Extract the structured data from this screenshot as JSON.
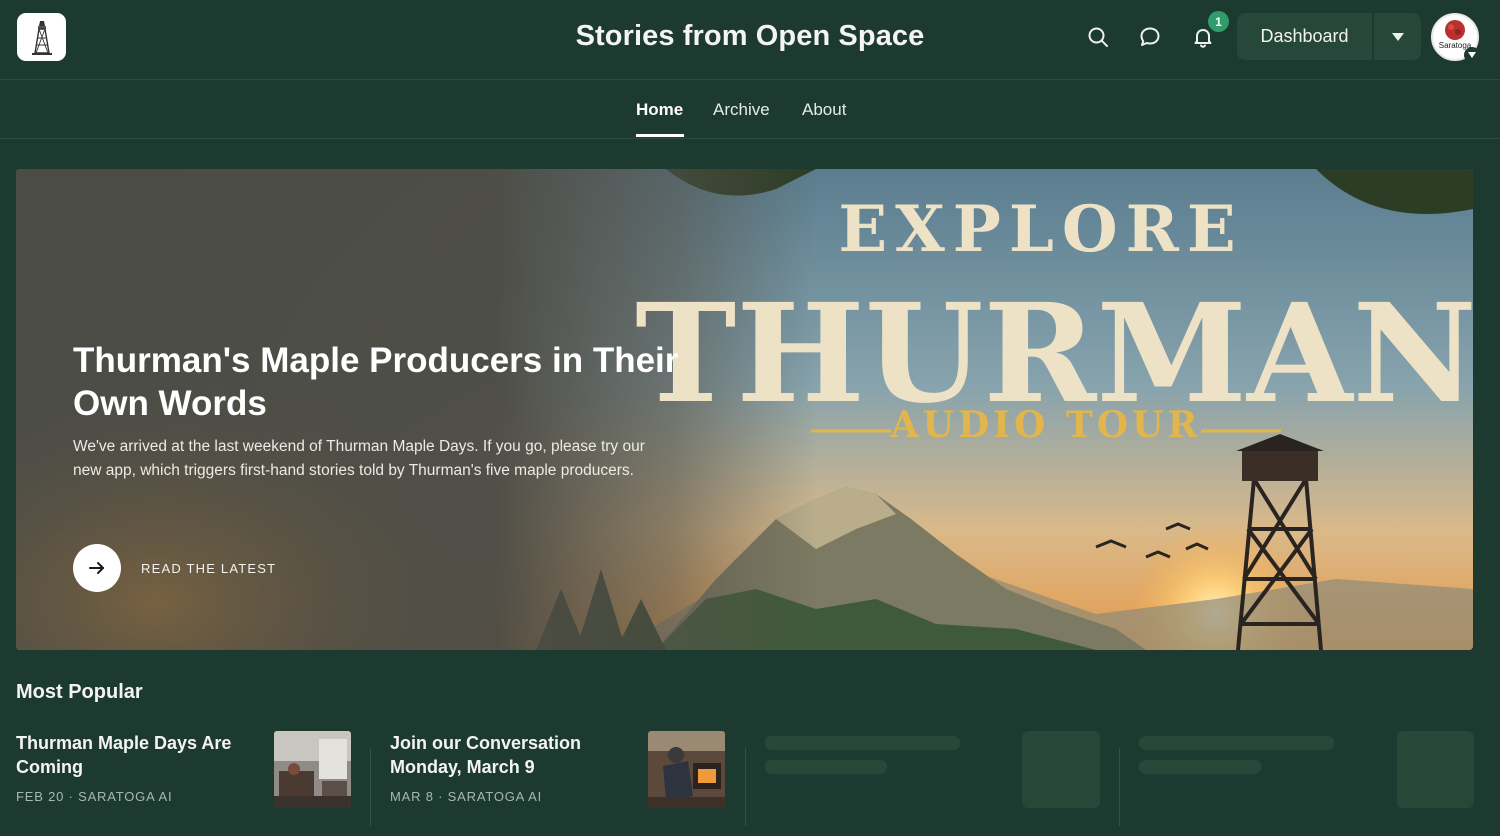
{
  "header": {
    "site_title": "Stories from Open Space",
    "notification_count": "1",
    "dashboard_label": "Dashboard",
    "avatar_text": "Saratoga"
  },
  "nav": {
    "items": [
      {
        "label": "Home",
        "active": true
      },
      {
        "label": "Archive",
        "active": false
      },
      {
        "label": "About",
        "active": false
      }
    ]
  },
  "hero": {
    "title": "Thurman's Maple Producers in Their Own Words",
    "description": "We've arrived at the last weekend of Thurman Maple Days. If you go, please try our new app, which triggers first-hand stories told by Thurman's five maple producers.",
    "cta_label": "READ THE LATEST",
    "art_line1": "EXPLORE",
    "art_line2": "THURMAN",
    "art_line3": "AUDIO TOUR"
  },
  "popular": {
    "title": "Most Popular",
    "posts": [
      {
        "title": "Thurman Maple Days Are Coming",
        "meta": "FEB 20 · SARATOGA AI"
      },
      {
        "title": "Join our Conversation Monday, March 9",
        "meta": "MAR 8 · SARATOGA AI"
      }
    ]
  },
  "colors": {
    "background": "#1c3a2f",
    "surface": "#27473a",
    "badge": "#2e9c6b"
  }
}
